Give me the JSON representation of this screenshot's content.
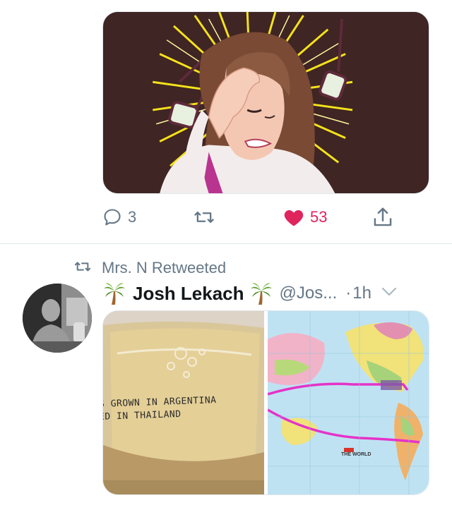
{
  "tweet_1": {
    "media_alt_icon": "facepalm-illustration",
    "actions": {
      "reply_count": "3",
      "retweet_count": "",
      "like_count": "53",
      "liked": true
    }
  },
  "retweet_context": {
    "label": "Mrs. N Retweeted",
    "icon": "retweet-icon"
  },
  "tweet_2": {
    "display_name": "Josh Lekach",
    "name_emoji": "palm-tree-icon",
    "handle": "@Jos...",
    "separator": "·",
    "time": "1h",
    "media": {
      "left_caption_line_1": "S GROWN IN ARGENTINA",
      "left_caption_line_2": "ED IN THAILAND",
      "right_logo_line_1": "THE WORLD"
    }
  },
  "colors": {
    "like_active": "#e0245e",
    "icon_gray": "#657786",
    "divider": "#e1e8ed",
    "text_primary": "#14171a"
  }
}
